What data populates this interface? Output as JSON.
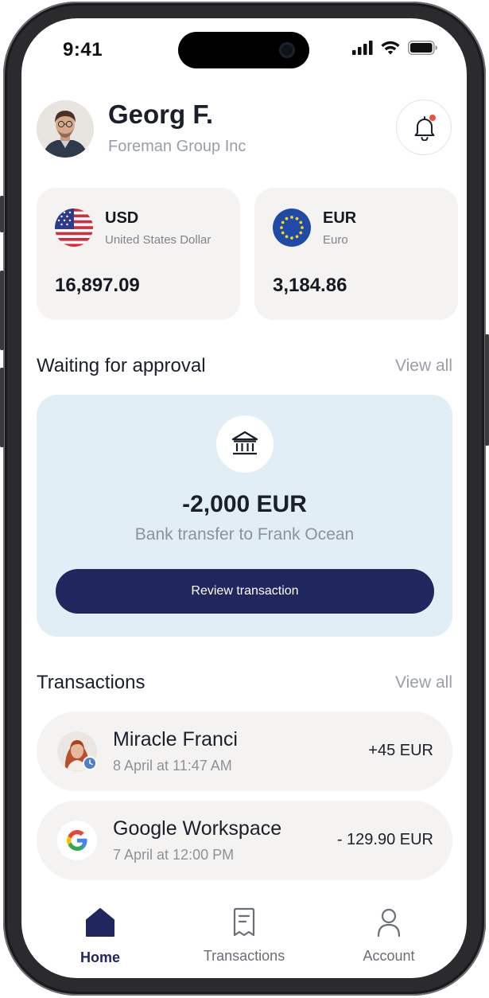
{
  "status_bar": {
    "time": "9:41"
  },
  "header": {
    "user_name": "Georg F.",
    "company": "Foreman Group Inc"
  },
  "accounts": [
    {
      "code": "USD",
      "name": "United States Dollar",
      "balance": "16,897.09",
      "flag": "us-flag-icon"
    },
    {
      "code": "EUR",
      "name": "Euro",
      "balance": "3,184.86",
      "flag": "eu-flag-icon"
    }
  ],
  "approval": {
    "title": "Waiting for approval",
    "view_all": "View all",
    "amount": "-2,000 EUR",
    "description": "Bank transfer to Frank Ocean",
    "button": "Review transaction",
    "icon": "bank-icon"
  },
  "transactions": {
    "title": "Transactions",
    "view_all": "View all",
    "items": [
      {
        "name": "Miracle Franci",
        "date": "8 April at 11:47 AM",
        "amount": "+45 EUR"
      },
      {
        "name": "Google Workspace",
        "date": "7 April at 12:00 PM",
        "amount": "- 129.90 EUR"
      }
    ]
  },
  "nav": {
    "items": [
      {
        "label": "Home",
        "icon": "home-icon",
        "active": true
      },
      {
        "label": "Transactions",
        "icon": "receipt-icon",
        "active": false
      },
      {
        "label": "Account",
        "icon": "person-icon",
        "active": false
      }
    ]
  },
  "colors": {
    "primary": "#20265e",
    "card_bg": "#f4f3f1",
    "approval_bg": "#e2eef5",
    "notification_dot": "#e8533a"
  }
}
